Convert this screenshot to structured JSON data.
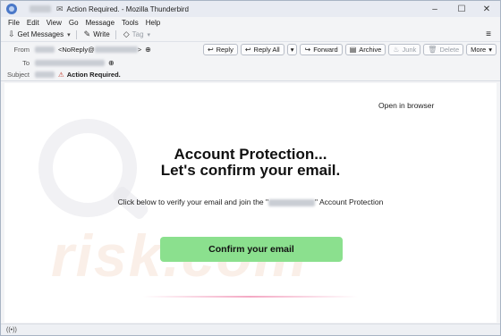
{
  "window": {
    "title": "Action Required. - Mozilla Thunderbird",
    "controls": [
      "–",
      "☐",
      "✕"
    ]
  },
  "menubar": [
    "File",
    "Edit",
    "View",
    "Go",
    "Message",
    "Tools",
    "Help"
  ],
  "toolbar": {
    "get_messages": "Get Messages",
    "write": "Write",
    "tag": "Tag",
    "menu_icon": "≡"
  },
  "header": {
    "from_label": "From",
    "from_value": "<NoReply@",
    "from_suffix": ">",
    "to_label": "To",
    "subject_label": "Subject",
    "subject_value": "Action Required.",
    "actions": {
      "reply": "Reply",
      "reply_all": "Reply All",
      "forward": "Forward",
      "archive": "Archive",
      "junk": "Junk",
      "delete": "Delete",
      "more": "More"
    }
  },
  "email": {
    "open_in_browser": "Open in browser",
    "heading_line1": "Account Protection...",
    "heading_line2": "Let's confirm your email.",
    "body_prefix": "Click below to verify your email and join the \"",
    "body_suffix": "\" Account Protection",
    "cta_label": "Confirm your email",
    "watermark": "risk.com"
  },
  "icons": {
    "app": "thunderbird-icon",
    "status": "wifi-icon"
  },
  "colors": {
    "cta": "#8be08e",
    "accent_line": "#f4a9c4"
  }
}
